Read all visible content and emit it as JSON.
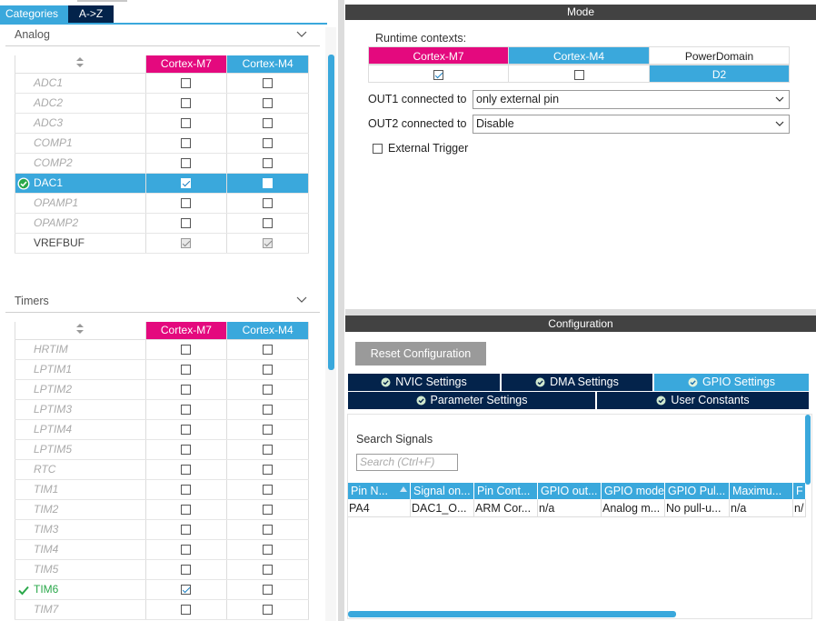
{
  "left": {
    "tabs": [
      "Categories",
      "A->Z"
    ],
    "analog": {
      "title": "Analog",
      "columns": [
        "Cortex-M7",
        "Cortex-M4"
      ],
      "rows": [
        {
          "name": "ADC1",
          "m7": "empty",
          "m4": "empty",
          "style": "disabled"
        },
        {
          "name": "ADC2",
          "m7": "empty",
          "m4": "empty",
          "style": "disabled"
        },
        {
          "name": "ADC3",
          "m7": "empty",
          "m4": "empty",
          "style": "disabled"
        },
        {
          "name": "COMP1",
          "m7": "empty",
          "m4": "empty",
          "style": "disabled"
        },
        {
          "name": "COMP2",
          "m7": "empty",
          "m4": "empty",
          "style": "disabled"
        },
        {
          "name": "DAC1",
          "m7": "checked",
          "m4": "empty",
          "style": "selected"
        },
        {
          "name": "OPAMP1",
          "m7": "empty",
          "m4": "empty",
          "style": "disabled"
        },
        {
          "name": "OPAMP2",
          "m7": "empty",
          "m4": "empty",
          "style": "disabled"
        },
        {
          "name": "VREFBUF",
          "m7": "gray-checked",
          "m4": "gray-checked",
          "style": "normal"
        }
      ]
    },
    "timers": {
      "title": "Timers",
      "columns": [
        "Cortex-M7",
        "Cortex-M4"
      ],
      "rows": [
        {
          "name": "HRTIM",
          "m7": "empty",
          "m4": "empty",
          "style": "disabled"
        },
        {
          "name": "LPTIM1",
          "m7": "empty",
          "m4": "empty",
          "style": "disabled"
        },
        {
          "name": "LPTIM2",
          "m7": "empty",
          "m4": "empty",
          "style": "disabled"
        },
        {
          "name": "LPTIM3",
          "m7": "empty",
          "m4": "empty",
          "style": "disabled"
        },
        {
          "name": "LPTIM4",
          "m7": "empty",
          "m4": "empty",
          "style": "disabled"
        },
        {
          "name": "LPTIM5",
          "m7": "empty",
          "m4": "empty",
          "style": "disabled"
        },
        {
          "name": "RTC",
          "m7": "empty",
          "m4": "empty",
          "style": "disabled"
        },
        {
          "name": "TIM1",
          "m7": "empty",
          "m4": "empty",
          "style": "disabled"
        },
        {
          "name": "TIM2",
          "m7": "empty",
          "m4": "empty",
          "style": "disabled"
        },
        {
          "name": "TIM3",
          "m7": "empty",
          "m4": "empty",
          "style": "disabled"
        },
        {
          "name": "TIM4",
          "m7": "empty",
          "m4": "empty",
          "style": "disabled"
        },
        {
          "name": "TIM5",
          "m7": "empty",
          "m4": "empty",
          "style": "disabled"
        },
        {
          "name": "TIM6",
          "m7": "checked",
          "m4": "empty",
          "style": "ok"
        },
        {
          "name": "TIM7",
          "m7": "empty",
          "m4": "empty",
          "style": "disabled"
        }
      ]
    }
  },
  "mode": {
    "header": "Mode",
    "runtime_label": "Runtime contexts:",
    "contexts": [
      "Cortex-M7",
      "Cortex-M4",
      "PowerDomain"
    ],
    "power_domain_value": "D2",
    "m7_checked": true,
    "m4_checked": false,
    "out1_label": "OUT1 connected to",
    "out1_value": "only external pin",
    "out2_label": "OUT2 connected to",
    "out2_value": "Disable",
    "ext_trigger_label": "External Trigger"
  },
  "config": {
    "header": "Configuration",
    "reset_label": "Reset Configuration",
    "tabs_row1": [
      "NVIC Settings",
      "DMA Settings",
      "GPIO Settings"
    ],
    "tabs_row2": [
      "Parameter Settings",
      "User Constants"
    ],
    "active_tab": "GPIO Settings",
    "search_label": "Search Signals",
    "search_placeholder": "Search (Ctrl+F)",
    "columns": [
      "Pin N...",
      "Signal on...",
      "Pin Cont...",
      "GPIO out...",
      "GPIO mode",
      "GPIO Pul...",
      "Maximu...",
      "F"
    ],
    "row": [
      "PA4",
      "DAC1_O...",
      "ARM Cor...",
      "n/a",
      "Analog m...",
      "No pull-u...",
      "n/a",
      "n/"
    ]
  },
  "colors": {
    "accent_blue": "#3aa8dc",
    "navy": "#03234b",
    "magenta": "#e4097e",
    "header_gray": "#424242",
    "ok_green": "#2aa84a"
  }
}
